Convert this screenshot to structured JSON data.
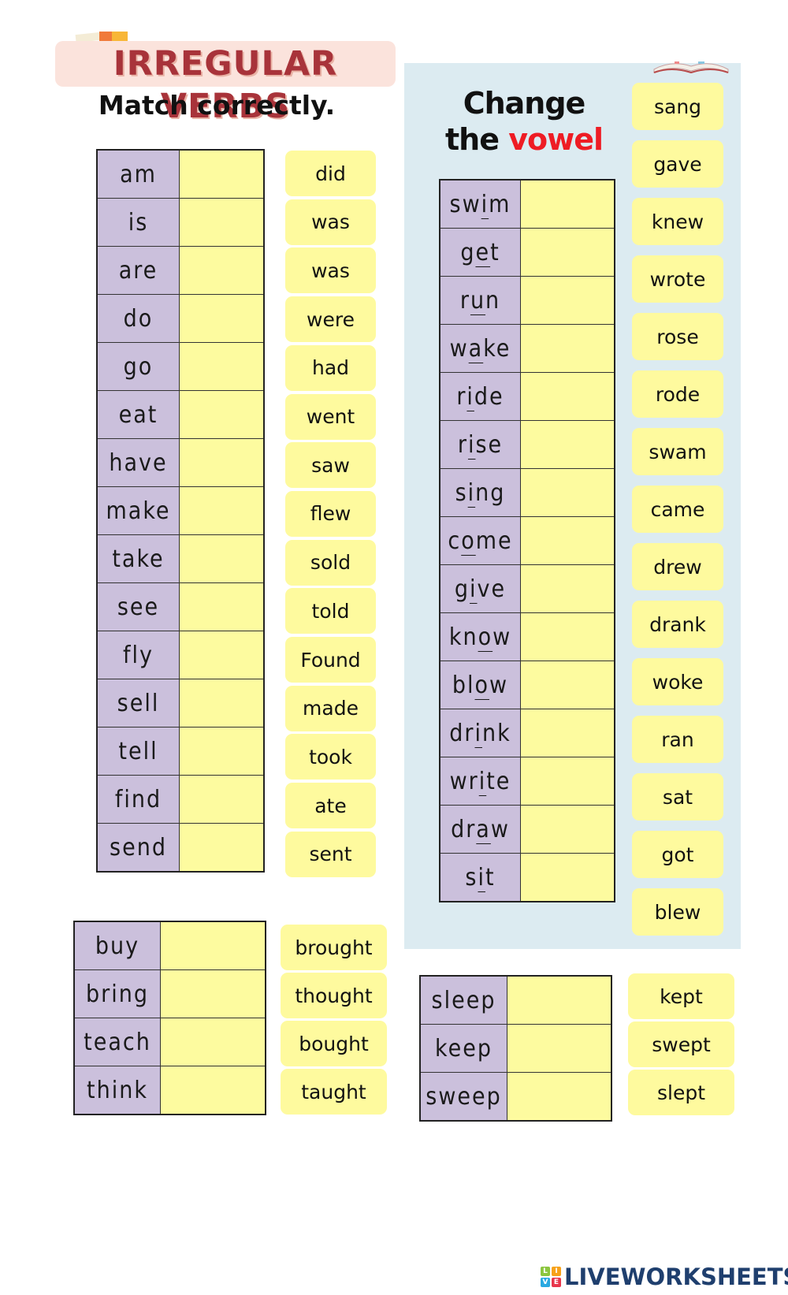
{
  "header": {
    "title": "IRREGULAR VERBS",
    "subtitle": "Match correctly."
  },
  "vowel_section": {
    "title_line1": "Change",
    "title_line2_prefix": "the ",
    "title_line2_highlight": "vowel",
    "highlight_color": "#ee1c24"
  },
  "colors": {
    "base_cell": "#cbc0dc",
    "answer_cell": "#fdfb9f",
    "tile": "#fefa9e",
    "panel": "#dcebf1",
    "title": "#a8333a"
  },
  "table1": {
    "verbs": [
      "am",
      "is",
      "are",
      "do",
      "go",
      "eat",
      "have",
      "make",
      "take",
      "see",
      "fly",
      "sell",
      "tell",
      "find",
      "send"
    ],
    "answers": [
      "",
      "",
      "",
      "",
      "",
      "",
      "",
      "",
      "",
      "",
      "",
      "",
      "",
      "",
      ""
    ],
    "tiles": [
      "did",
      "was",
      "was",
      "were",
      "had",
      "went",
      "saw",
      "flew",
      "sold",
      "told",
      "Found",
      "made",
      "took",
      "ate",
      "sent"
    ]
  },
  "table2": {
    "verbs": [
      {
        "pre": "sw",
        "vowel": "i",
        "post": "m"
      },
      {
        "pre": "g",
        "vowel": "e",
        "post": "t"
      },
      {
        "pre": "r",
        "vowel": "u",
        "post": "n"
      },
      {
        "pre": "w",
        "vowel": "a",
        "post": "ke"
      },
      {
        "pre": "r",
        "vowel": "i",
        "post": "de"
      },
      {
        "pre": "r",
        "vowel": "i",
        "post": "se"
      },
      {
        "pre": "s",
        "vowel": "i",
        "post": "ng"
      },
      {
        "pre": "c",
        "vowel": "o",
        "post": "me"
      },
      {
        "pre": "g",
        "vowel": "i",
        "post": "ve"
      },
      {
        "pre": "kn",
        "vowel": "o",
        "post": "w"
      },
      {
        "pre": "bl",
        "vowel": "o",
        "post": "w"
      },
      {
        "pre": "dr",
        "vowel": "i",
        "post": "nk"
      },
      {
        "pre": "wr",
        "vowel": "i",
        "post": "te"
      },
      {
        "pre": "dr",
        "vowel": "a",
        "post": "w"
      },
      {
        "pre": "s",
        "vowel": "i",
        "post": "t"
      }
    ],
    "answers": [
      "",
      "",
      "",
      "",
      "",
      "",
      "",
      "",
      "",
      "",
      "",
      "",
      "",
      "",
      ""
    ],
    "tiles": [
      "sang",
      "gave",
      "knew",
      "wrote",
      "rose",
      "rode",
      "swam",
      "came",
      "drew",
      "drank",
      "woke",
      "ran",
      "sat",
      "got",
      "blew"
    ]
  },
  "table3": {
    "verbs": [
      "buy",
      "bring",
      "teach",
      "think"
    ],
    "answers": [
      "",
      "",
      "",
      ""
    ],
    "tiles": [
      "brought",
      "thought",
      "bought",
      "taught"
    ]
  },
  "table4": {
    "verbs": [
      "sleep",
      "keep",
      "sweep"
    ],
    "answers": [
      "",
      "",
      ""
    ],
    "tiles": [
      "kept",
      "swept",
      "slept"
    ]
  },
  "footer": {
    "logo_text": "LIVEWORKSHEETS",
    "logo_letters": [
      "L",
      "I",
      "V",
      "E"
    ]
  }
}
